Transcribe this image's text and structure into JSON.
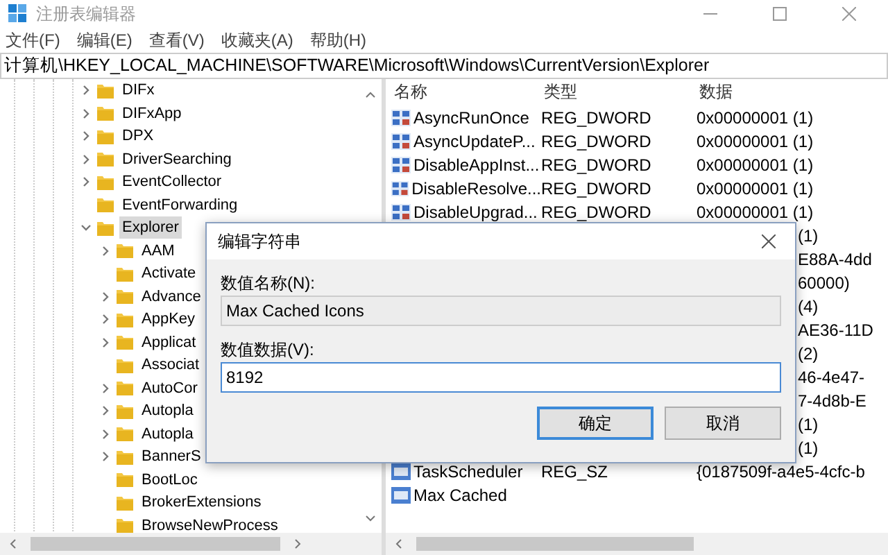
{
  "window": {
    "title": "注册表编辑器"
  },
  "menu": [
    "文件(F)",
    "编辑(E)",
    "查看(V)",
    "收藏夹(A)",
    "帮助(H)"
  ],
  "address": "计算机\\HKEY_LOCAL_MACHINE\\SOFTWARE\\Microsoft\\Windows\\CurrentVersion\\Explorer",
  "tree": [
    {
      "label": "DIFx",
      "kind": "branch",
      "expanded": false,
      "selected": false
    },
    {
      "label": "DIFxApp",
      "kind": "branch",
      "expanded": false,
      "selected": false
    },
    {
      "label": "DPX",
      "kind": "branch",
      "expanded": false,
      "selected": false
    },
    {
      "label": "DriverSearching",
      "kind": "branch",
      "expanded": false,
      "selected": false
    },
    {
      "label": "EventCollector",
      "kind": "branch",
      "expanded": false,
      "selected": false
    },
    {
      "label": "EventForwarding",
      "kind": "leaf",
      "selected": false
    },
    {
      "label": "Explorer",
      "kind": "branch",
      "expanded": true,
      "selected": true,
      "children": [
        {
          "label": "AAM",
          "kind": "branch",
          "expanded": false,
          "selected": false
        },
        {
          "label": "Activate",
          "kind": "leaf",
          "selected": false
        },
        {
          "label": "Advance",
          "kind": "branch",
          "expanded": false,
          "selected": false
        },
        {
          "label": "AppKey",
          "kind": "branch",
          "expanded": false,
          "selected": false
        },
        {
          "label": "Applicat",
          "kind": "branch",
          "expanded": false,
          "selected": false
        },
        {
          "label": "Associat",
          "kind": "leaf",
          "selected": false
        },
        {
          "label": "AutoCor",
          "kind": "branch",
          "expanded": false,
          "selected": false
        },
        {
          "label": "Autopla",
          "kind": "branch",
          "expanded": false,
          "selected": false
        },
        {
          "label": "Autopla",
          "kind": "branch",
          "expanded": false,
          "selected": false
        },
        {
          "label": "BannerS",
          "kind": "branch",
          "expanded": false,
          "selected": false
        },
        {
          "label": "BootLoc",
          "kind": "leaf",
          "selected": false
        },
        {
          "label": "BrokerExtensions",
          "kind": "leaf",
          "selected": false
        },
        {
          "label": "BrowseNewProcess",
          "kind": "leaf",
          "selected": false
        }
      ]
    }
  ],
  "list": {
    "columns": [
      "名称",
      "类型",
      "数据"
    ],
    "rows": [
      {
        "kind": "dword",
        "name": "AsyncRunOnce",
        "type": "REG_DWORD",
        "data": "0x00000001 (1)"
      },
      {
        "kind": "dword",
        "name": "AsyncUpdateP...",
        "type": "REG_DWORD",
        "data": "0x00000001 (1)"
      },
      {
        "kind": "dword",
        "name": "DisableAppInst...",
        "type": "REG_DWORD",
        "data": "0x00000001 (1)"
      },
      {
        "kind": "dword",
        "name": "DisableResolve...",
        "type": "REG_DWORD",
        "data": "0x00000001 (1)"
      },
      {
        "kind": "dword",
        "name": "DisableUpgrad...",
        "type": "REG_DWORD",
        "data": "0x00000001 (1)"
      },
      {
        "kind": "hidden",
        "data": "(1)"
      },
      {
        "kind": "hidden",
        "data": "E88A-4dd"
      },
      {
        "kind": "hidden",
        "data": "60000)"
      },
      {
        "kind": "hidden",
        "data": "(4)"
      },
      {
        "kind": "hidden",
        "data": "AE36-11D"
      },
      {
        "kind": "hidden",
        "data": "(2)"
      },
      {
        "kind": "hidden",
        "data": "46-4e47-"
      },
      {
        "kind": "hidden",
        "data": "7-4d8b-E"
      },
      {
        "kind": "hidden",
        "data": "(1)"
      },
      {
        "kind": "hidden",
        "data": "(1)"
      },
      {
        "kind": "string",
        "name": "TaskScheduler",
        "type": "REG_SZ",
        "data": "{0187509f-a4e5-4cfc-b"
      },
      {
        "kind": "string",
        "name": "Max Cached"
      }
    ]
  },
  "dialog": {
    "title": "编辑字符串",
    "name_label": "数值名称(N):",
    "name_value": "Max Cached Icons",
    "data_label": "数值数据(V):",
    "data_value": "8192",
    "buttons": [
      "确定",
      "取消"
    ]
  }
}
